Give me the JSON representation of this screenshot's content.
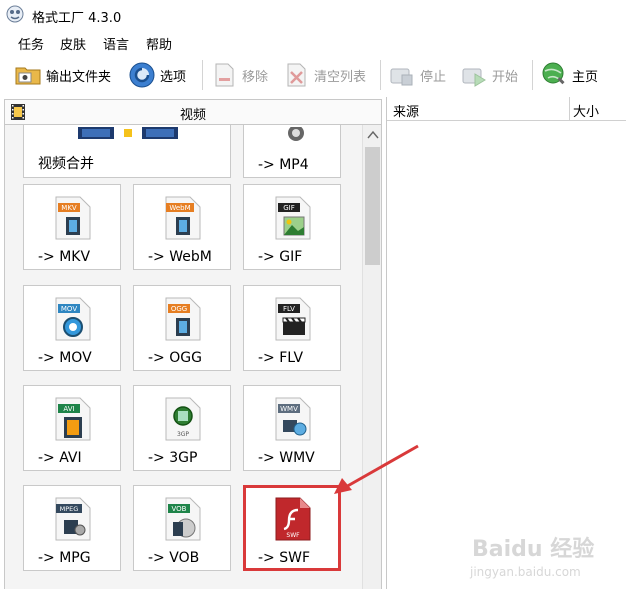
{
  "window": {
    "title": "格式工厂 4.3.0"
  },
  "menu": [
    "任务",
    "皮肤",
    "语言",
    "帮助"
  ],
  "toolbar": {
    "output_folder": "输出文件夹",
    "options": "选项",
    "remove": "移除",
    "clear_list": "清空列表",
    "stop": "停止",
    "start": "开始",
    "home": "主页"
  },
  "left_panel": {
    "category": "视频",
    "tiles": [
      {
        "label": "视频合并",
        "icon": "video-merge-icon"
      },
      {
        "label": "-> MP4",
        "icon": "mp4-icon"
      },
      {
        "label": "-> MKV",
        "icon": "mkv-icon",
        "badge": "MKV"
      },
      {
        "label": "-> WebM",
        "icon": "webm-icon",
        "badge": "WebM"
      },
      {
        "label": "-> GIF",
        "icon": "gif-icon",
        "badge": "GIF"
      },
      {
        "label": "-> MOV",
        "icon": "mov-icon",
        "badge": "MOV"
      },
      {
        "label": "-> OGG",
        "icon": "ogg-icon",
        "badge": "OGG"
      },
      {
        "label": "-> FLV",
        "icon": "flv-icon",
        "badge": "FLV"
      },
      {
        "label": "-> AVI",
        "icon": "avi-icon",
        "badge": "AVI"
      },
      {
        "label": "-> 3GP",
        "icon": "3gp-icon",
        "badge": "3GP"
      },
      {
        "label": "-> WMV",
        "icon": "wmv-icon",
        "badge": "WMV"
      },
      {
        "label": "-> MPG",
        "icon": "mpg-icon",
        "badge": "MPEG"
      },
      {
        "label": "-> VOB",
        "icon": "vob-icon",
        "badge": "VOB"
      },
      {
        "label": "-> SWF",
        "icon": "swf-icon",
        "badge": "SWF"
      }
    ]
  },
  "right_panel": {
    "col_source": "来源",
    "col_size": "大小"
  },
  "watermark": {
    "brand": "Baidu 经验",
    "url": "jingyan.baidu.com"
  },
  "colors": {
    "highlight": "#d9393a",
    "accent_blue": "#1e6fbf"
  }
}
